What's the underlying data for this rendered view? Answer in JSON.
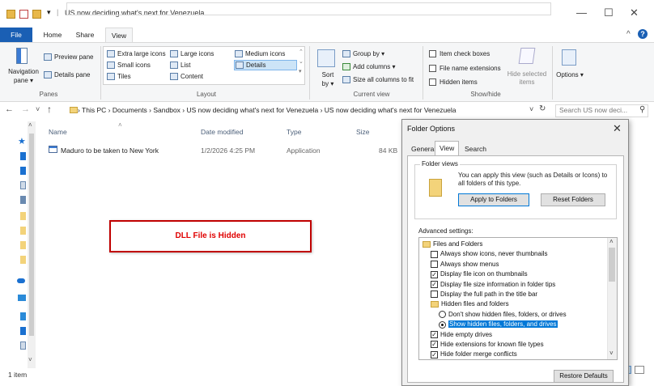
{
  "window": {
    "title": "US now deciding what's next for Venezuela",
    "controls": {
      "minimize": "—",
      "maximize": "☐",
      "close": "✕",
      "expand": "^",
      "help": "?"
    }
  },
  "ribbon": {
    "tabs": [
      "File",
      "Home",
      "Share",
      "View"
    ],
    "panes": {
      "label": "Panes",
      "navigation_pane": "Navigation pane ▾",
      "preview_pane": "Preview pane",
      "details_pane": "Details pane"
    },
    "layout": {
      "label": "Layout",
      "items": [
        "Extra large icons",
        "Large icons",
        "Medium icons",
        "Small icons",
        "List",
        "Details",
        "Tiles",
        "Content"
      ]
    },
    "current_view": {
      "label": "Current view",
      "sort_by": "Sort by ▾",
      "group_by": "Group by ▾",
      "add_columns": "Add columns ▾",
      "size_all": "Size all columns to fit"
    },
    "show_hide": {
      "label": "Show/hide",
      "item_check_boxes": "Item check boxes",
      "file_name_extensions": "File name extensions",
      "hidden_items": "Hidden items",
      "hide_selected": "Hide selected items",
      "options": "Options ▾"
    }
  },
  "address": {
    "back": "←",
    "forward": "→",
    "recent": "˅",
    "up": "↑",
    "crumbs": "› This PC › Documents › Sandbox › US now deciding what's next for Venezuela › US now deciding what's next for Venezuela",
    "dropdown": "˅",
    "refresh": "↻",
    "search_placeholder": "Search US now deci...",
    "search_icon": "⚲"
  },
  "file_list": {
    "columns": {
      "name": "Name",
      "date": "Date modified",
      "type": "Type",
      "size": "Size"
    },
    "rows": [
      {
        "name": "Maduro to be taken to New York",
        "date": "1/2/2026 4:25 PM",
        "type": "Application",
        "size": "84 KB"
      }
    ],
    "annotation": "DLL File is Hidden",
    "status": "1 item"
  },
  "dialog": {
    "title": "Folder Options",
    "close": "✕",
    "tabs": [
      "General",
      "View",
      "Search"
    ],
    "folder_views": {
      "legend": "Folder views",
      "description": "You can apply this view (such as Details or Icons) to all folders of this type.",
      "apply": "Apply to Folders",
      "reset": "Reset Folders"
    },
    "advanced_label": "Advanced settings:",
    "tree": [
      {
        "kind": "folder",
        "label": "Files and Folders",
        "indent": 0
      },
      {
        "kind": "check",
        "checked": false,
        "label": "Always show icons, never thumbnails",
        "indent": 1
      },
      {
        "kind": "check",
        "checked": false,
        "label": "Always show menus",
        "indent": 1
      },
      {
        "kind": "check",
        "checked": true,
        "label": "Display file icon on thumbnails",
        "indent": 1
      },
      {
        "kind": "check",
        "checked": true,
        "label": "Display file size information in folder tips",
        "indent": 1
      },
      {
        "kind": "check",
        "checked": false,
        "label": "Display the full path in the title bar",
        "indent": 1
      },
      {
        "kind": "folder",
        "label": "Hidden files and folders",
        "indent": 1
      },
      {
        "kind": "radio",
        "checked": false,
        "label": "Don't show hidden files, folders, or drives",
        "indent": 2
      },
      {
        "kind": "radio",
        "checked": true,
        "label": "Show hidden files, folders, and drives",
        "indent": 2,
        "selected": true
      },
      {
        "kind": "check",
        "checked": true,
        "label": "Hide empty drives",
        "indent": 1
      },
      {
        "kind": "check",
        "checked": true,
        "label": "Hide extensions for known file types",
        "indent": 1
      },
      {
        "kind": "check",
        "checked": true,
        "label": "Hide folder merge conflicts",
        "indent": 1
      }
    ],
    "restore": "Restore Defaults",
    "scroll_up": "˄",
    "scroll_down": "˅"
  }
}
